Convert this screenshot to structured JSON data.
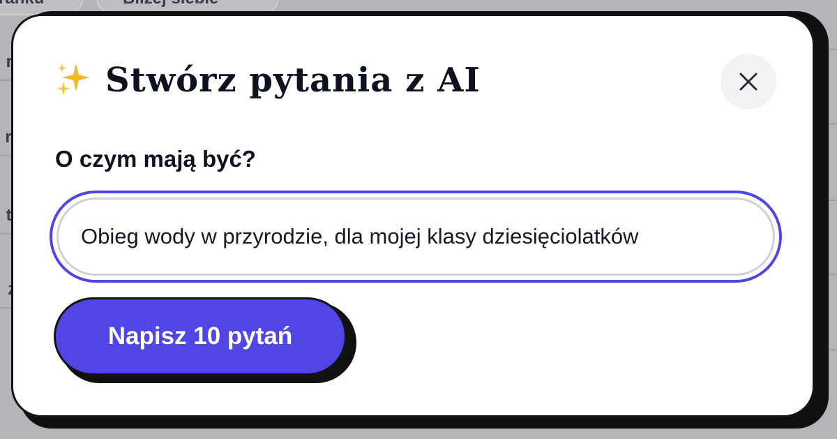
{
  "background": {
    "pills": [
      "ranku",
      "Bliżej siebie"
    ],
    "row_fragments": [
      "rz",
      "ra",
      "te",
      "zi"
    ]
  },
  "modal": {
    "title": "Stwórz pytania z AI",
    "title_icon": "sparkles-icon",
    "close_icon": "close-icon",
    "field_label": "O czym mają być?",
    "topic_input_value": "Obieg wody w przyrodzie, dla mojej klasy dziesięciolatków",
    "submit_label": "Napisz 10 pytań"
  },
  "colors": {
    "accent": "#4f46e5",
    "overlay": "#b4b5bb",
    "sparkle": "#f5b82e",
    "text": "#0e1120"
  }
}
